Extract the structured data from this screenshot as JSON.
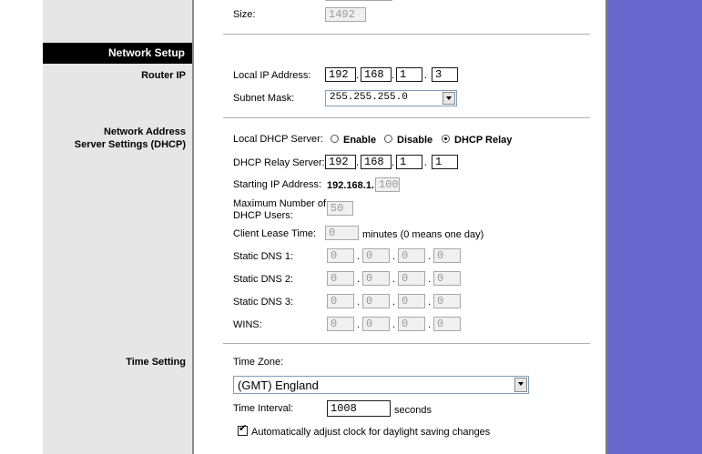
{
  "sidebar": {
    "section_title": "Network Setup",
    "router_ip": "Router IP",
    "dhcp_line1": "Network Address",
    "dhcp_line2": "Server Settings (DHCP)",
    "time_setting": "Time Setting"
  },
  "size": {
    "label": "Size:",
    "value": "1492"
  },
  "router_ip": {
    "local_ip_label": "Local IP Address:",
    "local_ip": [
      "192",
      "168",
      "1",
      "3"
    ],
    "subnet_label": "Subnet Mask:",
    "subnet_value": "255.255.255.0"
  },
  "dhcp": {
    "server_label": "Local DHCP Server:",
    "options": [
      "Enable",
      "Disable",
      "DHCP Relay"
    ],
    "selected": "DHCP Relay",
    "relay_label": "DHCP Relay Server:",
    "relay_ip": [
      "192",
      "168",
      "1",
      "1"
    ],
    "start_label": "Starting IP Address:",
    "start_prefix": "192.168.1.",
    "start_value": "100",
    "max_users_label1": "Maximum Number of",
    "max_users_label2": "DHCP Users:",
    "max_users": "50",
    "lease_label": "Client Lease Time:",
    "lease_value": "0",
    "lease_suffix": "minutes (0 means one day)",
    "dns1_label": "Static DNS 1:",
    "dns1": [
      "0",
      "0",
      "0",
      "0"
    ],
    "dns2_label": "Static DNS 2:",
    "dns2": [
      "0",
      "0",
      "0",
      "0"
    ],
    "dns3_label": "Static DNS 3:",
    "dns3": [
      "0",
      "0",
      "0",
      "0"
    ],
    "wins_label": "WINS:",
    "wins": [
      "0",
      "0",
      "0",
      "0"
    ]
  },
  "time": {
    "zone_label": "Time Zone:",
    "zone_value": "(GMT) England",
    "interval_label": "Time Interval:",
    "interval_value": "1008",
    "interval_suffix": "seconds",
    "dst_label": "Automatically adjust clock for daylight saving changes",
    "dst_checked": true
  },
  "colors": {
    "accent_purple": "#6666cc",
    "sidebar_gray": "#e6e6e6",
    "section_bar": "#000000"
  }
}
